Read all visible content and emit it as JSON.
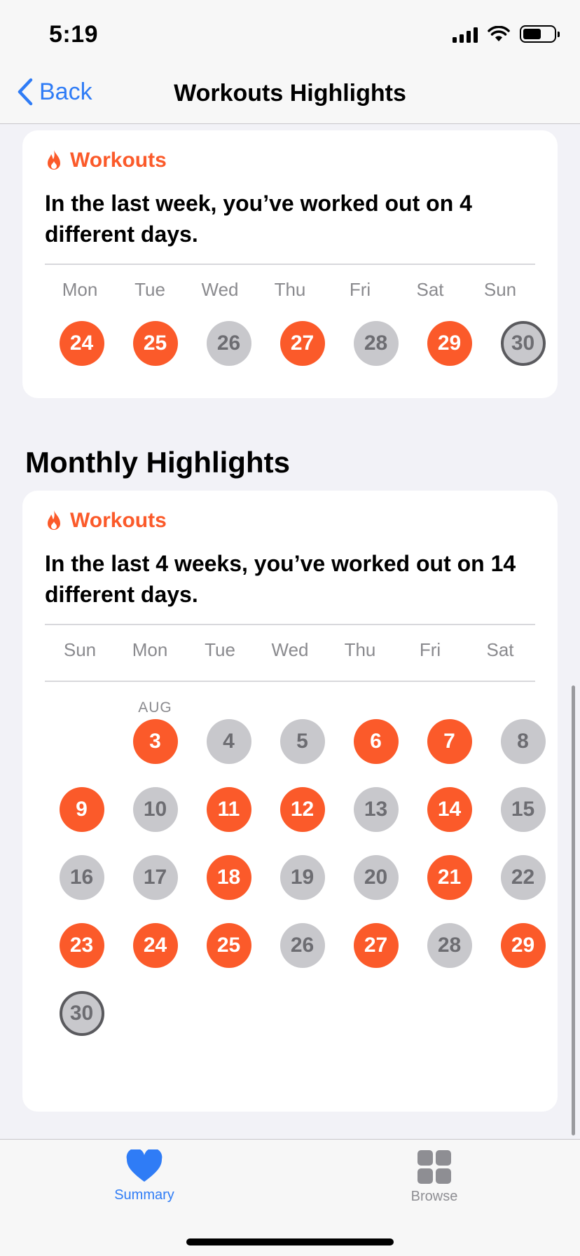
{
  "status_bar": {
    "time": "5:19"
  },
  "nav": {
    "back_label": "Back",
    "title": "Workouts Highlights"
  },
  "weekly": {
    "header": "Workouts",
    "text": "In the last week, you’ve worked out on 4 different days.",
    "day_labels": [
      "Mon",
      "Tue",
      "Wed",
      "Thu",
      "Fri",
      "Sat",
      "Sun"
    ],
    "days": [
      {
        "num": "24",
        "state": "active"
      },
      {
        "num": "25",
        "state": "active"
      },
      {
        "num": "26",
        "state": "inactive"
      },
      {
        "num": "27",
        "state": "active"
      },
      {
        "num": "28",
        "state": "inactive"
      },
      {
        "num": "29",
        "state": "active"
      },
      {
        "num": "30",
        "state": "today"
      }
    ]
  },
  "monthly": {
    "section_title": "Monthly Highlights",
    "header": "Workouts",
    "text": "In the last 4 weeks, you’ve worked out on 14 different days.",
    "day_labels": [
      "Sun",
      "Mon",
      "Tue",
      "Wed",
      "Thu",
      "Fri",
      "Sat"
    ],
    "month_label": "AUG",
    "weeks": [
      [
        null,
        {
          "num": "3",
          "state": "active"
        },
        {
          "num": "4",
          "state": "inactive"
        },
        {
          "num": "5",
          "state": "inactive"
        },
        {
          "num": "6",
          "state": "active"
        },
        {
          "num": "7",
          "state": "active"
        },
        {
          "num": "8",
          "state": "inactive"
        }
      ],
      [
        {
          "num": "9",
          "state": "active"
        },
        {
          "num": "10",
          "state": "inactive"
        },
        {
          "num": "11",
          "state": "active"
        },
        {
          "num": "12",
          "state": "active"
        },
        {
          "num": "13",
          "state": "inactive"
        },
        {
          "num": "14",
          "state": "active"
        },
        {
          "num": "15",
          "state": "inactive"
        }
      ],
      [
        {
          "num": "16",
          "state": "inactive"
        },
        {
          "num": "17",
          "state": "inactive"
        },
        {
          "num": "18",
          "state": "active"
        },
        {
          "num": "19",
          "state": "inactive"
        },
        {
          "num": "20",
          "state": "inactive"
        },
        {
          "num": "21",
          "state": "active"
        },
        {
          "num": "22",
          "state": "inactive"
        }
      ],
      [
        {
          "num": "23",
          "state": "active"
        },
        {
          "num": "24",
          "state": "active"
        },
        {
          "num": "25",
          "state": "active"
        },
        {
          "num": "26",
          "state": "inactive"
        },
        {
          "num": "27",
          "state": "active"
        },
        {
          "num": "28",
          "state": "inactive"
        },
        {
          "num": "29",
          "state": "active"
        }
      ],
      [
        {
          "num": "30",
          "state": "today"
        },
        null,
        null,
        null,
        null,
        null,
        null
      ]
    ]
  },
  "tabs": [
    {
      "label": "Summary",
      "icon": "heart-icon",
      "selected": true
    },
    {
      "label": "Browse",
      "icon": "grid-icon",
      "selected": false
    }
  ],
  "colors": {
    "accent": "#fb5a2a",
    "link": "#2f7cf6",
    "inactive": "#c8c8cc"
  }
}
